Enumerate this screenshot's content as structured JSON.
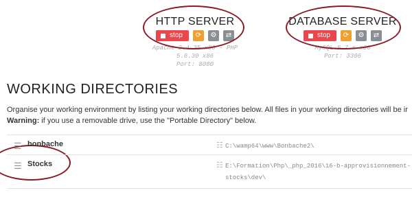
{
  "servers": [
    {
      "title": "HTTP SERVER",
      "stop_label": "stop",
      "info_line1": "Apache 2.4.35 x86 - PHP 5.6.30 x86",
      "info_line2": "Port: 8080"
    },
    {
      "title": "DATABASE SERVER",
      "stop_label": "stop",
      "info_line1": "MySQL 5.7.x x86",
      "info_line2": "Port: 3306"
    }
  ],
  "icons": {
    "stop": "stop-square-icon",
    "restart": "refresh-icon",
    "settings": "gear-icon",
    "switch": "swap-arrows-icon",
    "handle": "drag-handle-icon",
    "path": "list-icon"
  },
  "colors": {
    "stop": "#e9474e",
    "restart": "#f0a030",
    "neutral": "#8a8f96",
    "annotation": "#8b1a22"
  },
  "working_dirs": {
    "heading": "WORKING DIRECTORIES",
    "description": "Organise your working environment by listing your working directories below. All files in your working directories will be ir",
    "warning_label": "Warning:",
    "warning_text": " if you use a removable drive, use the \"Portable Directory\" below.",
    "items": [
      {
        "name": "bonbache",
        "path": "C:\\wamp64\\www\\Bonbache2\\"
      },
      {
        "name": "Stocks",
        "path": "E:\\Formation\\Php\\_php_2016\\16-b-approvisionnement-stocks\\dev\\"
      }
    ]
  }
}
